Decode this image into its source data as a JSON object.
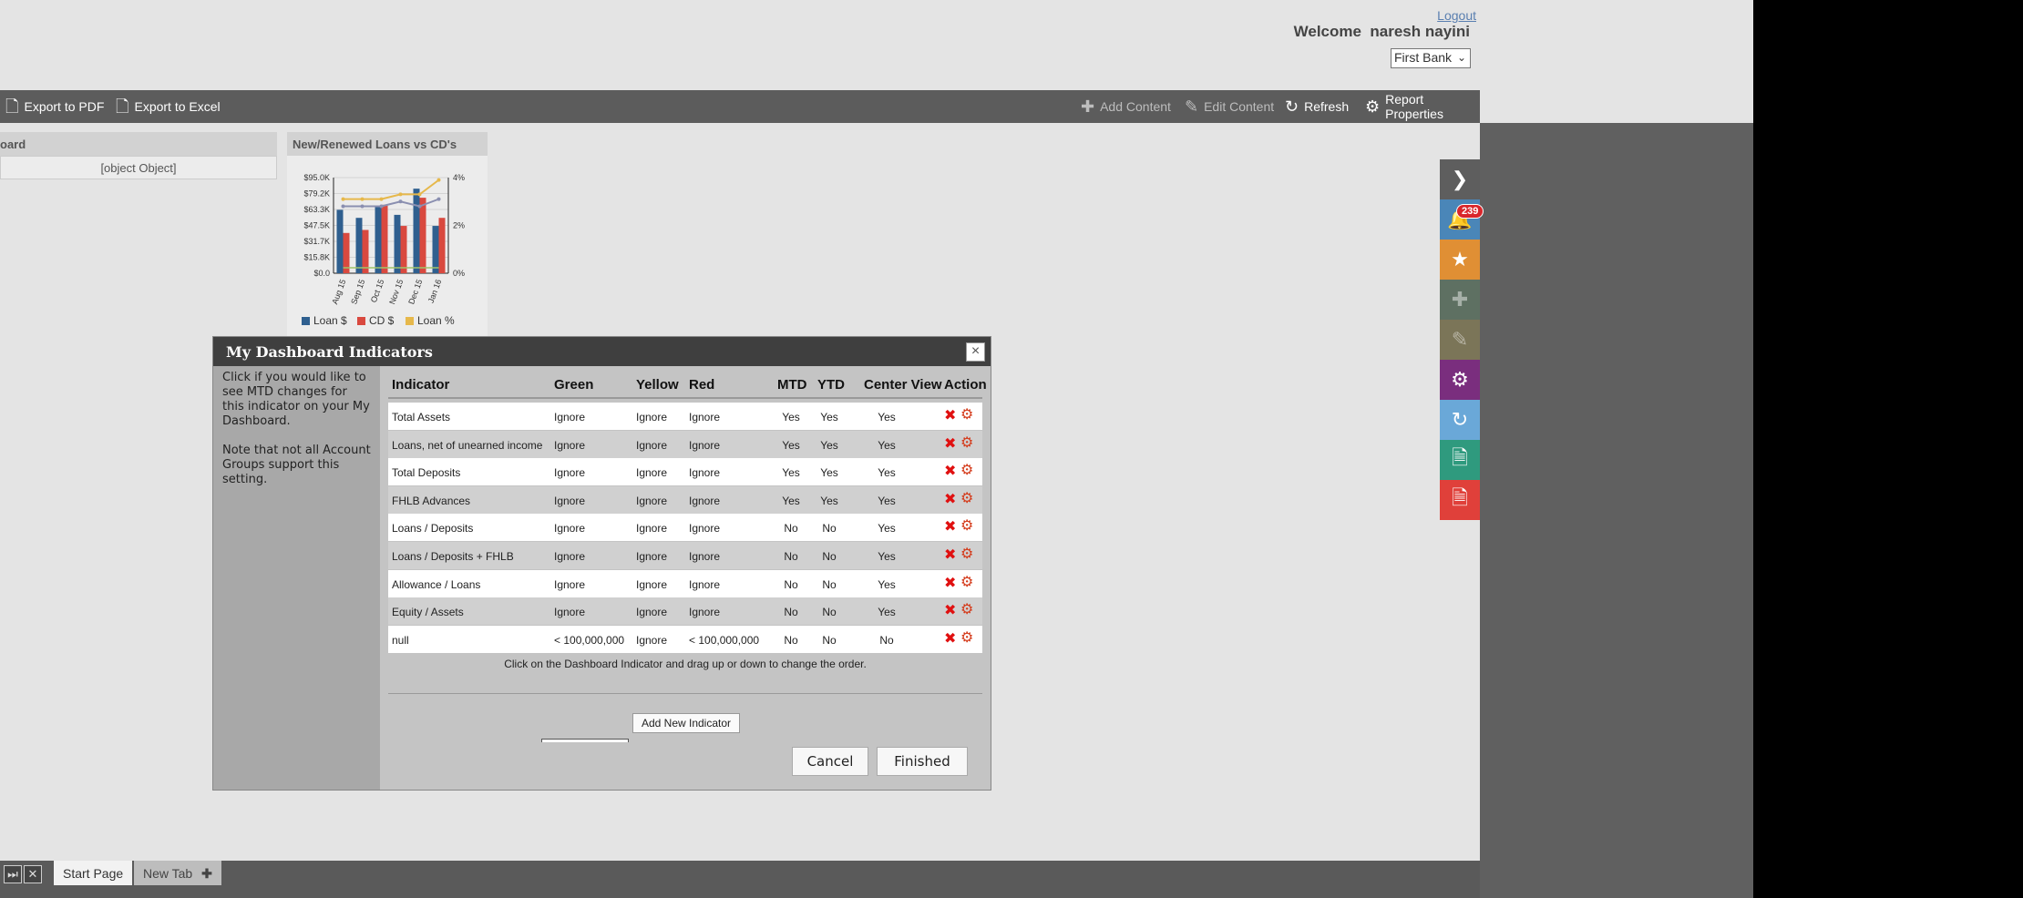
{
  "header": {
    "logout": "Logout",
    "welcome": "Welcome  naresh nayini",
    "bank_select": "First Bank"
  },
  "toolbar": {
    "export_pdf": "Export to PDF",
    "export_excel": "Export to Excel",
    "add_content": "Add Content",
    "edit_content": "Edit Content",
    "refresh": "Refresh",
    "report_properties": "Report Properties"
  },
  "widgets": {
    "left": {
      "title": "oard",
      "body": "[object Object]"
    },
    "chart": {
      "title": "New/Renewed Loans vs CD's"
    }
  },
  "chart_data": {
    "type": "bar",
    "categories": [
      "Aug 15",
      "Sep 15",
      "Oct 15",
      "Nov 15",
      "Dec 15",
      "Jan 16"
    ],
    "series": [
      {
        "name": "Loan $",
        "values": [
          63000,
          55000,
          66000,
          58000,
          84000,
          47000
        ],
        "color": "#2f5f8f"
      },
      {
        "name": "CD $",
        "values": [
          40000,
          43000,
          68000,
          47000,
          75000,
          55000
        ],
        "color": "#d9493f"
      },
      {
        "name": "Loan %",
        "values": [
          3.1,
          3.1,
          3.1,
          3.3,
          3.3,
          3.9
        ],
        "axis": "right",
        "color": "#e6b84b"
      },
      {
        "name": "",
        "values": [
          2.8,
          2.8,
          2.8,
          3.0,
          2.8,
          3.1
        ],
        "axis": "right",
        "color": "#8a8fb0"
      }
    ],
    "y_ticks": [
      "$95.0K",
      "$79.2K",
      "$63.3K",
      "$47.5K",
      "$31.7K",
      "$15.8K",
      "$0.0"
    ],
    "y2_ticks": [
      "4%",
      "2%",
      "0%"
    ],
    "ylim": [
      0,
      95000
    ],
    "y2lim": [
      0,
      4
    ],
    "legend": [
      "Loan $",
      "CD $",
      "Loan %"
    ]
  },
  "dialog": {
    "title": "My Dashboard Indicators",
    "close": "×",
    "help_1": "Click if you would like to see MTD changes for this indicator on your My Dashboard.",
    "help_2": "Note that not all Account Groups support this setting.",
    "columns": [
      "Indicator",
      "Green",
      "Yellow",
      "Red",
      "MTD",
      "YTD",
      "Center View",
      "Action"
    ],
    "rows": [
      {
        "indicator": "Total Assets",
        "green": "Ignore",
        "yellow": "Ignore",
        "red": "Ignore",
        "mtd": "Yes",
        "ytd": "Yes",
        "center": "Yes"
      },
      {
        "indicator": "Loans, net of unearned income",
        "green": "Ignore",
        "yellow": "Ignore",
        "red": "Ignore",
        "mtd": "Yes",
        "ytd": "Yes",
        "center": "Yes"
      },
      {
        "indicator": "Total Deposits",
        "green": "Ignore",
        "yellow": "Ignore",
        "red": "Ignore",
        "mtd": "Yes",
        "ytd": "Yes",
        "center": "Yes"
      },
      {
        "indicator": "FHLB Advances",
        "green": "Ignore",
        "yellow": "Ignore",
        "red": "Ignore",
        "mtd": "Yes",
        "ytd": "Yes",
        "center": "Yes"
      },
      {
        "indicator": "Loans / Deposits",
        "green": "Ignore",
        "yellow": "Ignore",
        "red": "Ignore",
        "mtd": "No",
        "ytd": "No",
        "center": "Yes"
      },
      {
        "indicator": "Loans / Deposits + FHLB",
        "green": "Ignore",
        "yellow": "Ignore",
        "red": "Ignore",
        "mtd": "No",
        "ytd": "No",
        "center": "Yes"
      },
      {
        "indicator": "Allowance / Loans",
        "green": "Ignore",
        "yellow": "Ignore",
        "red": "Ignore",
        "mtd": "No",
        "ytd": "No",
        "center": "Yes"
      },
      {
        "indicator": "Equity / Assets",
        "green": "Ignore",
        "yellow": "Ignore",
        "red": "Ignore",
        "mtd": "No",
        "ytd": "No",
        "center": "Yes"
      },
      {
        "indicator": "null",
        "green": "< 100,000,000",
        "yellow": "Ignore",
        "red": "< 100,000,000",
        "mtd": "No",
        "ytd": "No",
        "center": "No"
      }
    ],
    "drag_hint": "Click on the Dashboard Indicator and drag up or down to change the order.",
    "add_button": "Add New Indicator",
    "cancel": "Cancel",
    "finished": "Finished"
  },
  "side": {
    "badge": "239",
    "colors": [
      "#5e5e5e",
      "#4a86b8",
      "#e08f34",
      "#5e7062",
      "#7b7558",
      "#7a2e7e",
      "#6aa8d8",
      "#2f9a7e",
      "#e0403a"
    ]
  },
  "tabs": {
    "start": "Start Page",
    "new": "New Tab"
  }
}
